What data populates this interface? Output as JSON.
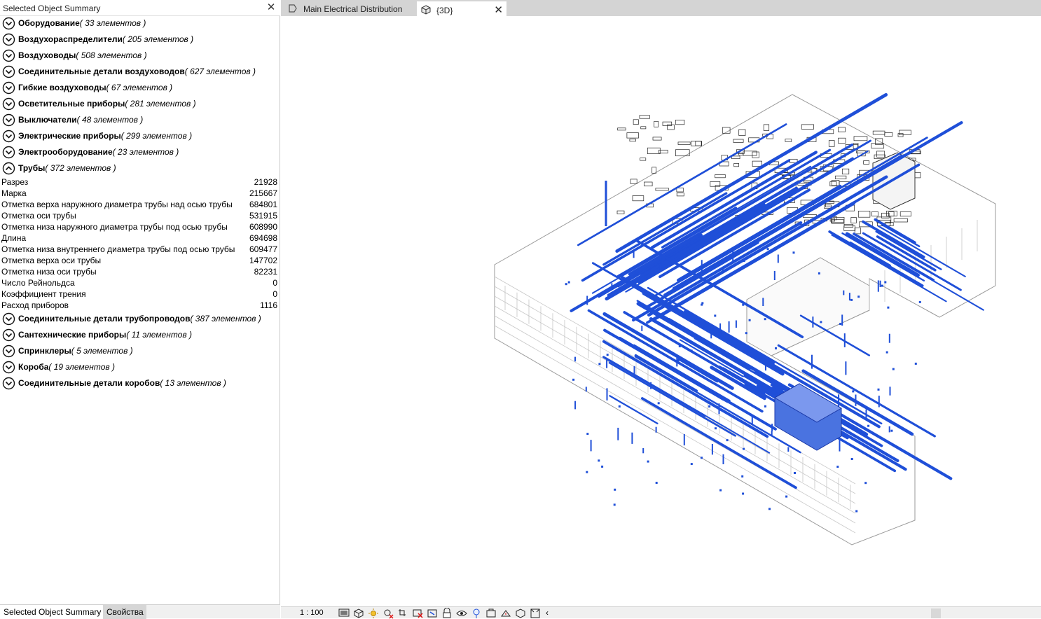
{
  "left_panel": {
    "title": "Selected Object Summary",
    "close_icon": "close-icon",
    "categories_top": [
      {
        "name": "Оборудование",
        "count": "( 33 элементов )",
        "expanded": false
      },
      {
        "name": "Воздухораспределители",
        "count": "( 205 элементов )",
        "expanded": false
      },
      {
        "name": "Воздуховоды",
        "count": "( 508 элементов )",
        "expanded": false
      },
      {
        "name": "Соединительные детали воздуховодов",
        "count": "( 627 элементов )",
        "expanded": false
      },
      {
        "name": "Гибкие воздуховоды",
        "count": "( 67 элементов )",
        "expanded": false
      },
      {
        "name": "Осветительные приборы",
        "count": "( 281 элементов )",
        "expanded": false
      },
      {
        "name": "Выключатели",
        "count": "( 48 элементов )",
        "expanded": false
      },
      {
        "name": "Электрические приборы",
        "count": "( 299 элементов )",
        "expanded": false
      },
      {
        "name": "Электрооборудование",
        "count": "( 23 элементов )",
        "expanded": false
      },
      {
        "name": "Трубы",
        "count": "( 372 элементов )",
        "expanded": true
      }
    ],
    "pipe_properties": [
      {
        "name": "Разрез",
        "value": "21928"
      },
      {
        "name": "Марка",
        "value": "215667"
      },
      {
        "name": "Отметка верха наружного диаметра трубы над осью трубы",
        "value": "684801"
      },
      {
        "name": "Отметка оси трубы",
        "value": "531915"
      },
      {
        "name": "Отметка низа наружного диаметра трубы под осью трубы",
        "value": "608990"
      },
      {
        "name": "Длина",
        "value": "694698"
      },
      {
        "name": "Отметка низа внутреннего диаметра трубы под осью трубы",
        "value": "609477"
      },
      {
        "name": "Отметка верха оси трубы",
        "value": "147702"
      },
      {
        "name": "Отметка низа оси трубы",
        "value": "82231"
      },
      {
        "name": "Число Рейнольдса",
        "value": "0"
      },
      {
        "name": "Коэффициент трения",
        "value": "0"
      },
      {
        "name": "Расход приборов",
        "value": "1116"
      }
    ],
    "categories_bottom": [
      {
        "name": "Соединительные детали трубопроводов",
        "count": "( 387 элементов )",
        "expanded": false
      },
      {
        "name": "Сантехнические приборы",
        "count": "( 11 элементов )",
        "expanded": false
      },
      {
        "name": "Спринклеры",
        "count": "( 5 элементов )",
        "expanded": false
      },
      {
        "name": "Короба",
        "count": "( 19 элементов )",
        "expanded": false
      },
      {
        "name": "Соединительные детали коробов",
        "count": "( 13 элементов )",
        "expanded": false
      }
    ],
    "bottom_tabs": {
      "active": "Selected Object Summary",
      "inactive": "Свойства"
    }
  },
  "document_tabs": [
    {
      "label": "Main Electrical Distribution",
      "icon": "floor-plan-icon",
      "active": false
    },
    {
      "label": "{3D}",
      "icon": "3d-view-icon",
      "active": true,
      "close_icon": "close-icon"
    }
  ],
  "status_bar": {
    "scale": "1 : 100",
    "icons": [
      "detail-level-icon",
      "visual-style-icon",
      "sun-path-icon",
      "shadows-icon",
      "crop-view-icon",
      "show-crop-icon",
      "unlock-3d-view-icon",
      "temporary-hide-icon",
      "reveal-hidden-icon",
      "temporary-view-properties-icon",
      "analytical-model-icon",
      "highlight-displacement-icon",
      "show-constraints-icon",
      "section-box-icon"
    ],
    "collapse_arrow": "‹"
  },
  "colors": {
    "pipe_blue": "#1f4fd8",
    "building_line": "#9a9a9a",
    "tab_bg": "#d4d4d4"
  }
}
